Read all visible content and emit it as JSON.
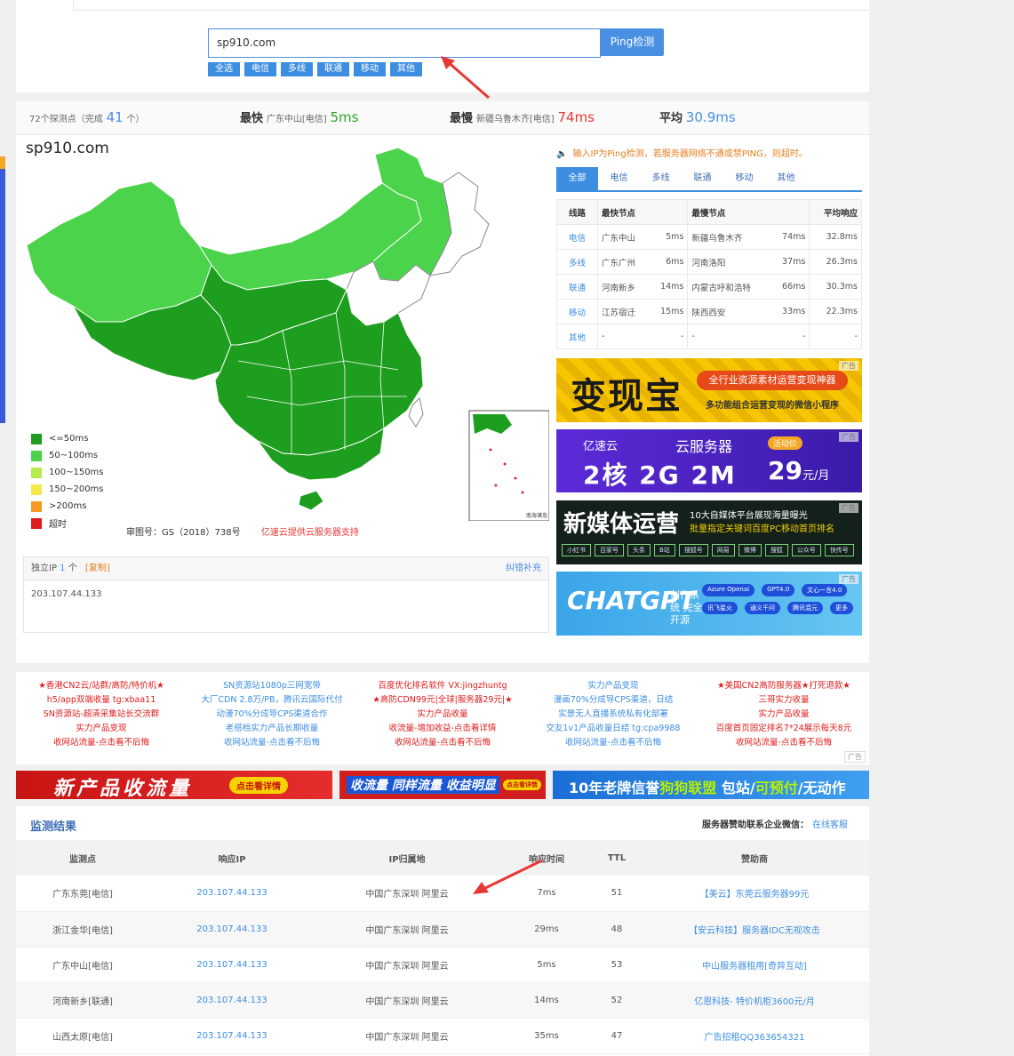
{
  "search": {
    "value": "sp910.com",
    "button": "Ping检测"
  },
  "filters": [
    "全选",
    "电信",
    "多线",
    "联通",
    "移动",
    "其他"
  ],
  "stats": {
    "count_prefix": "72个探测点（完成",
    "count_done": "41",
    "count_suffix": "个）",
    "fastest_label": "最快",
    "fastest_node": "广东中山[电信]",
    "fastest_value": "5ms",
    "slowest_label": "最慢",
    "slowest_node": "新疆乌鲁木齐[电信]",
    "slowest_value": "74ms",
    "avg_label": "平均",
    "avg_value": "30.9ms"
  },
  "map": {
    "title": "sp910.com",
    "legend": [
      "<=50ms",
      "50~100ms",
      "100~150ms",
      "150~200ms",
      ">200ms",
      "超时"
    ],
    "legend_colors": [
      "#1e9e1e",
      "#4cd34c",
      "#b5ec4b",
      "#f4e84a",
      "#f59a23",
      "#e01b1b"
    ],
    "foot_left": "审图号：GS（2018）738号",
    "foot_right": "亿速云提供云服务器支持"
  },
  "ip_box": {
    "label": "独立IP",
    "count": "1",
    "unit": "个",
    "copy": "[复制]",
    "fix": "纠错补充",
    "ip": "203.107.44.133"
  },
  "notice": "输入IP为Ping检测，若服务器网络不通或禁PING，则超时。",
  "tabs": [
    "全部",
    "电信",
    "多线",
    "联通",
    "移动",
    "其他"
  ],
  "isp_table": {
    "headers": [
      "线路",
      "最快节点",
      "最慢节点",
      "平均响应"
    ],
    "rows": [
      {
        "isp": "电信",
        "fast": "广东中山",
        "fast_ms": "5ms",
        "slow": "新疆乌鲁木齐",
        "slow_ms": "74ms",
        "avg": "32.8ms"
      },
      {
        "isp": "多线",
        "fast": "广东广州",
        "fast_ms": "6ms",
        "slow": "河南洛阳",
        "slow_ms": "37ms",
        "avg": "26.3ms"
      },
      {
        "isp": "联通",
        "fast": "河南新乡",
        "fast_ms": "14ms",
        "slow": "内蒙古呼和浩特",
        "slow_ms": "66ms",
        "avg": "30.3ms"
      },
      {
        "isp": "移动",
        "fast": "江苏宿迁",
        "fast_ms": "15ms",
        "slow": "陕西西安",
        "slow_ms": "33ms",
        "avg": "22.3ms"
      },
      {
        "isp": "其他",
        "fast": "-",
        "fast_ms": "-",
        "slow": "-",
        "slow_ms": "-",
        "avg": "-"
      }
    ]
  },
  "ads": {
    "tag": "广告",
    "ad1": {
      "big": "变现宝",
      "pill": "全行业资源素材运营变现神器",
      "sub": "多功能组合运营变现的微信小程序"
    },
    "ad2": {
      "brand": "亿速云",
      "svc": "云服务器",
      "hot": "活动价",
      "spec": "2核 2G 2M",
      "price": "29",
      "unit": "元/月"
    },
    "ad3": {
      "big": "新媒体运营",
      "l1": "10大自媒体平台展现海量曝光",
      "l2": "批量指定关键词百度PC移动首页排名",
      "boxes": [
        "小红书",
        "百家号",
        "头条",
        "B站",
        "搜狐号",
        "网易",
        "微博",
        "搜狐",
        "公众号",
        "快传号"
      ]
    },
    "ad4": {
      "big": "CHATGPT",
      "sub": "创作系统 完全开源",
      "pills": [
        "Azure Openai",
        "GPT4.0",
        "文心一言4.0",
        "讯飞星火",
        "通义千问",
        "腾讯混元",
        "更多"
      ]
    }
  },
  "links": [
    [
      "★香港CN2云/站群/高防/特价机★",
      "h5/app双端收量 tg:xbaa11",
      "SN资源站-超清采集站长交流群",
      "实力产品变现",
      "收网站流量-点击看不后悔"
    ],
    [
      "SN资源站1080p三网宽带",
      "大厂CDN 2.8万/PB，腾讯云国际代付",
      "动漫70%分成导CPS渠道合作",
      "老搭档实力产品长期收量",
      "收网站流量-点击看不后悔"
    ],
    [
      "百度优化排名软件 VX:jingzhuntg",
      "★高防CDN99元|全球|服务器29元|★",
      "实力产品收量",
      "收流量-增加收益-点击看详情",
      "收网站流量-点击看不后悔"
    ],
    [
      "实力产品变现",
      "漫画70%分成导CPS渠道，日结",
      "实景无人直播系统私有化部署",
      "交友1v1产品收量日结 tg:cpa9988",
      "收网站流量-点击看不后悔"
    ],
    [
      "★美国CN2高防服务器★打死退款★",
      "三哥实力收量",
      "实力产品收量",
      "百度首页固定排名7*24展示每天8元",
      "收网站流量-点击看不后悔"
    ]
  ],
  "links_colors": [
    "#e01b1b",
    "#3d8ee0",
    "#e01b1b",
    "#3d8ee0",
    "#e01b1b"
  ],
  "links_tag": "广告",
  "banners": {
    "b1": {
      "text": "新产品收流量",
      "btn": "点击看详情"
    },
    "b2": {
      "text": "收流量 同样流量 收益明显",
      "btn": "点击看详情"
    },
    "b3": {
      "pre": "10年老牌信誉",
      "hl1": "狗狗联盟",
      "mid": " 包站/",
      "hl2": "可预付",
      "post": "/无动作"
    }
  },
  "results": {
    "title": "监测结果",
    "sponsor_label": "服务器赞助联系企业微信：",
    "sponsor_link": "在线客服",
    "headers": [
      "监测点",
      "响应IP",
      "IP归属地",
      "响应时间",
      "TTL",
      "赞助商"
    ],
    "rows": [
      {
        "node": "广东东莞[电信]",
        "ip": "203.107.44.133",
        "loc": "中国广东深圳 阿里云",
        "time": "7ms",
        "ttl": "51",
        "sponsor": "【美云】东莞云服务器99元"
      },
      {
        "node": "浙江金华[电信]",
        "ip": "203.107.44.133",
        "loc": "中国广东深圳 阿里云",
        "time": "29ms",
        "ttl": "48",
        "sponsor": "【安云科技】服务器IDC无视攻击"
      },
      {
        "node": "广东中山[电信]",
        "ip": "203.107.44.133",
        "loc": "中国广东深圳 阿里云",
        "time": "5ms",
        "ttl": "53",
        "sponsor": "中山服务器租用[奇异互动]"
      },
      {
        "node": "河南新乡[联通]",
        "ip": "203.107.44.133",
        "loc": "中国广东深圳 阿里云",
        "time": "14ms",
        "ttl": "52",
        "sponsor": "亿恩科技- 特价机柜3600元/月"
      },
      {
        "node": "山西太原[电信]",
        "ip": "203.107.44.133",
        "loc": "中国广东深圳 阿里云",
        "time": "35ms",
        "ttl": "47",
        "sponsor": "广告招租QQ363654321"
      }
    ]
  }
}
